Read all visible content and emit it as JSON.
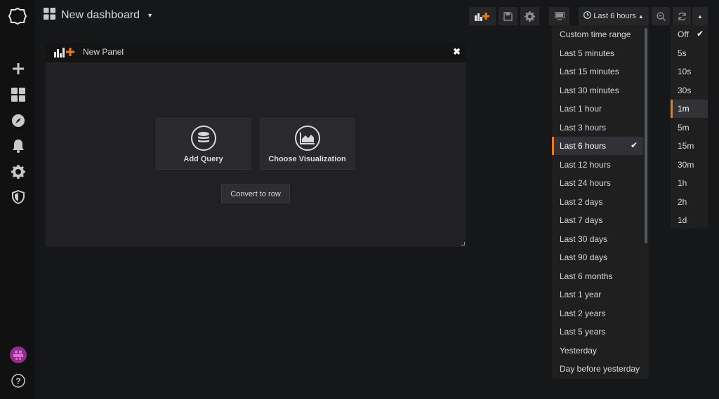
{
  "app": {
    "accent_color": "#eb7b18",
    "background_color": "#161719"
  },
  "sidebar": {
    "items": [
      {
        "name": "create",
        "icon": "plus-icon"
      },
      {
        "name": "dashboards",
        "icon": "dashboards-grid-icon"
      },
      {
        "name": "explore",
        "icon": "compass-icon"
      },
      {
        "name": "alerting",
        "icon": "bell-icon"
      },
      {
        "name": "configuration",
        "icon": "gear-icon"
      },
      {
        "name": "server-admin",
        "icon": "shield-icon"
      },
      {
        "name": "profile",
        "icon": "avatar"
      },
      {
        "name": "help",
        "icon": "question-icon"
      }
    ]
  },
  "header": {
    "dashboard_title": "New dashboard",
    "time_picker_label": "Last 6 hours"
  },
  "panel": {
    "title": "New Panel",
    "actions": {
      "add_query": "Add Query",
      "choose_visualization": "Choose Visualization",
      "convert_to_row": "Convert to row"
    }
  },
  "time_range_menu": {
    "items": [
      "Custom time range",
      "Last 5 minutes",
      "Last 15 minutes",
      "Last 30 minutes",
      "Last 1 hour",
      "Last 3 hours",
      "Last 6 hours",
      "Last 12 hours",
      "Last 24 hours",
      "Last 2 days",
      "Last 7 days",
      "Last 30 days",
      "Last 90 days",
      "Last 6 months",
      "Last 1 year",
      "Last 2 years",
      "Last 5 years",
      "Yesterday",
      "Day before yesterday"
    ],
    "selected": "Last 6 hours"
  },
  "refresh_menu": {
    "items": [
      "Off",
      "5s",
      "10s",
      "30s",
      "1m",
      "5m",
      "15m",
      "30m",
      "1h",
      "2h",
      "1d"
    ],
    "checked": "Off",
    "highlighted": "1m"
  }
}
